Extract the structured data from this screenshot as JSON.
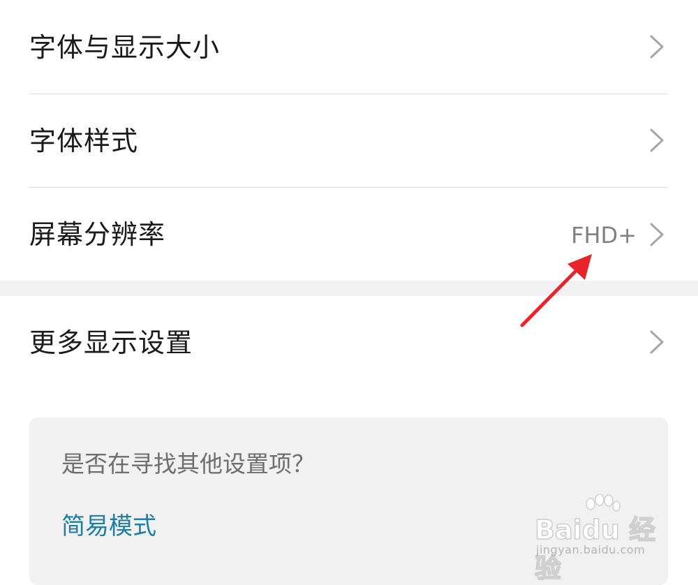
{
  "settings": {
    "items": [
      {
        "label": "字体与显示大小",
        "value": ""
      },
      {
        "label": "字体样式",
        "value": ""
      },
      {
        "label": "屏幕分辨率",
        "value": "FHD+"
      },
      {
        "label": "更多显示设置",
        "value": ""
      }
    ]
  },
  "suggestion": {
    "question": "是否在寻找其他设置项？",
    "link_label": "简易模式"
  },
  "watermark": {
    "brand": "Baidu 经验",
    "url": "jingyan.baidu.com"
  },
  "icons": {
    "row_chevron": "chevron-right-icon",
    "annotation": "red-arrow-annotation"
  },
  "colors": {
    "link": "#1f7ea1",
    "annotation_arrow": "#e8232a",
    "section_gap": "#f2f2f2"
  }
}
